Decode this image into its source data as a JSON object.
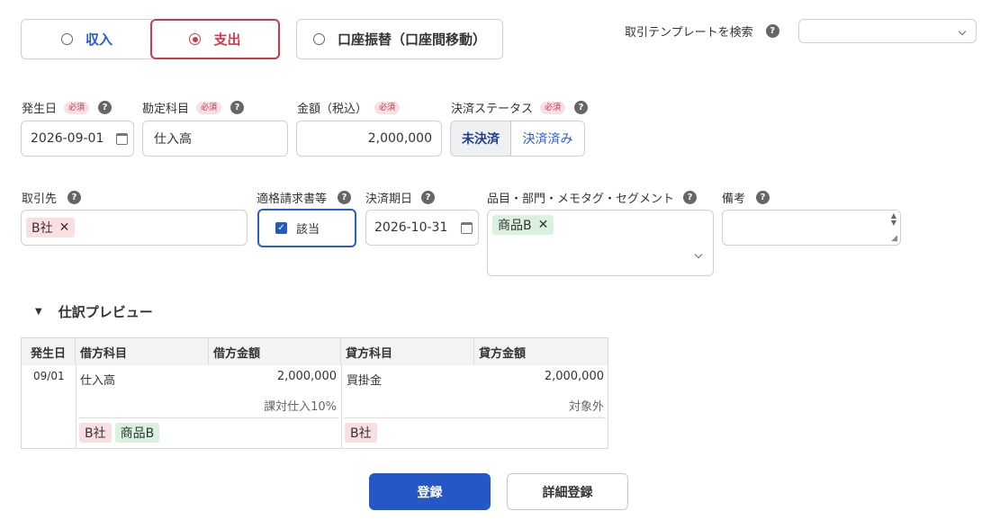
{
  "type_toggle": {
    "income": "収入",
    "expense": "支出",
    "transfer": "口座振替（口座間移動）"
  },
  "template_search": {
    "label": "取引テンプレートを検索",
    "value": ""
  },
  "required_badge": "必須",
  "help_mark": "?",
  "fields": {
    "issue_date": {
      "label": "発生日",
      "value": "2026-09-01"
    },
    "account": {
      "label": "勘定科目",
      "value": "仕入高"
    },
    "amount": {
      "label": "金額（税込）",
      "value": "2,000,000"
    },
    "settlement_status": {
      "label": "決済ステータス",
      "unpaid": "未決済",
      "paid": "決済済み"
    },
    "partner": {
      "label": "取引先",
      "tag": "B社"
    },
    "qualified_invoice": {
      "label": "適格請求書等",
      "checkbox_label": "該当",
      "checked": true
    },
    "due_date": {
      "label": "決済期日",
      "value": "2026-10-31"
    },
    "item_tags": {
      "label": "品目・部門・メモタグ・セグメント",
      "tag": "商品B"
    },
    "remarks": {
      "label": "備考",
      "value": ""
    }
  },
  "preview": {
    "title": "仕訳プレビュー",
    "headers": {
      "date": "発生日",
      "debit_account": "借方科目",
      "debit_amount": "借方金額",
      "credit_account": "貸方科目",
      "credit_amount": "貸方金額"
    },
    "row": {
      "date": "09/01",
      "debit_account": "仕入高",
      "debit_amount": "2,000,000",
      "debit_tax": "課対仕入10%",
      "debit_tags": [
        "B社",
        "商品B"
      ],
      "credit_account": "買掛金",
      "credit_amount": "2,000,000",
      "credit_tax": "対象外",
      "credit_tags": [
        "B社"
      ]
    }
  },
  "buttons": {
    "register": "登録",
    "detail_register": "詳細登録"
  },
  "colors": {
    "primary": "#2657c6",
    "expense_red": "#d33848",
    "income_blue": "#2a5bd7",
    "required_bg": "#f9dfe2",
    "tag_green_bg": "#d9f1de"
  }
}
